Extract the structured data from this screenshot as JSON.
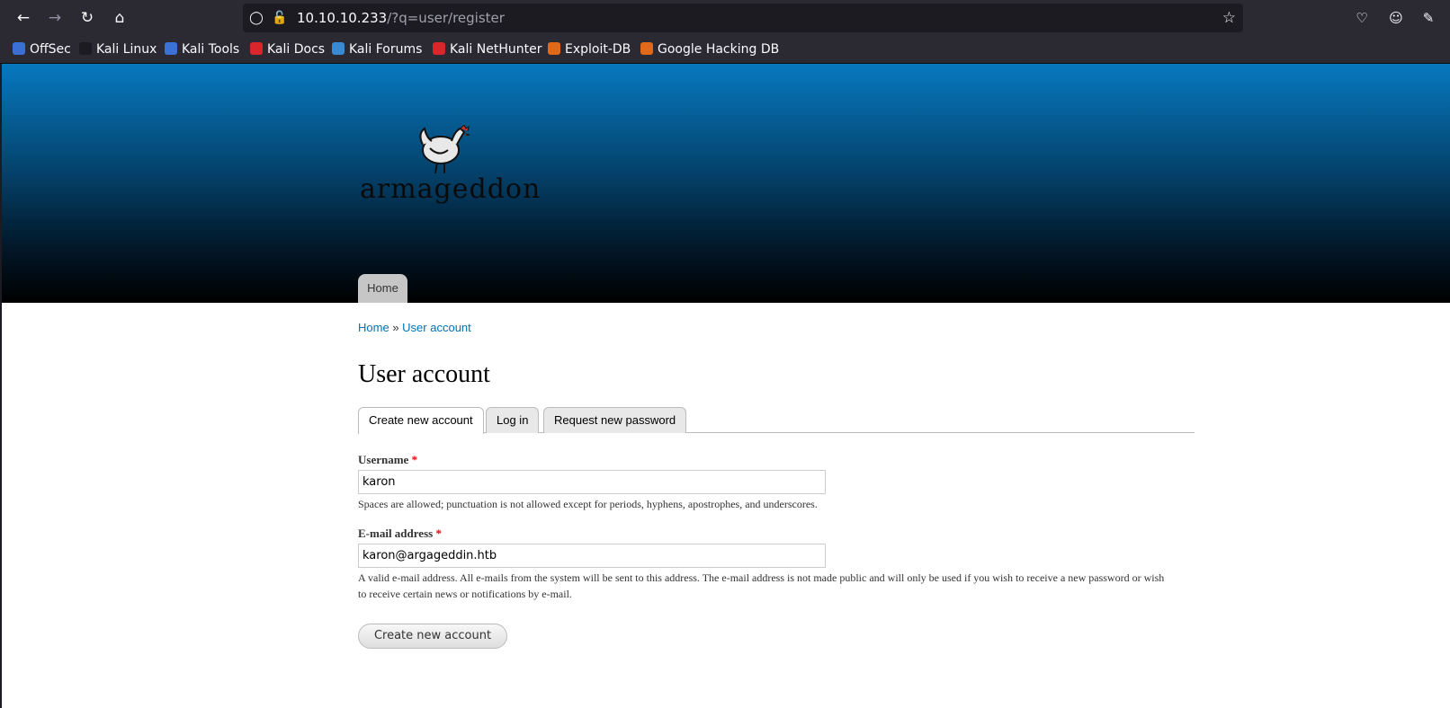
{
  "browser": {
    "url_host": "10.10.10.233",
    "url_path": "/?q=user/register",
    "bookmarks": [
      {
        "label": "OffSec",
        "color": "#3b6fd4"
      },
      {
        "label": "Kali Linux",
        "color": "#1c1b22"
      },
      {
        "label": "Kali Tools",
        "color": "#3c72d6"
      },
      {
        "label": "Kali Docs",
        "color": "#d8262b"
      },
      {
        "label": "Kali Forums",
        "color": "#3a8ad3"
      },
      {
        "label": "Kali NetHunter",
        "color": "#d8262b"
      },
      {
        "label": "Exploit-DB",
        "color": "#e06a1a"
      },
      {
        "label": "Google Hacking DB",
        "color": "#e06a1a"
      }
    ]
  },
  "site": {
    "logo_text": "armageddon",
    "nav_home": "Home"
  },
  "breadcrumb": {
    "home": "Home",
    "separator": "»",
    "current": "User account"
  },
  "page_title": "User account",
  "tabs": [
    {
      "label": "Create new account",
      "active": true
    },
    {
      "label": "Log in",
      "active": false
    },
    {
      "label": "Request new password",
      "active": false
    }
  ],
  "form": {
    "username_label": "Username",
    "required_mark": "*",
    "username_value": "karon",
    "username_desc": "Spaces are allowed; punctuation is not allowed except for periods, hyphens, apostrophes, and underscores.",
    "email_label": "E-mail address",
    "email_value": "karon@argageddin.htb",
    "email_desc": "A valid e-mail address. All e-mails from the system will be sent to this address. The e-mail address is not made public and will only be used if you wish to receive a new password or wish to receive certain news or notifications by e-mail.",
    "submit_label": "Create new account"
  }
}
